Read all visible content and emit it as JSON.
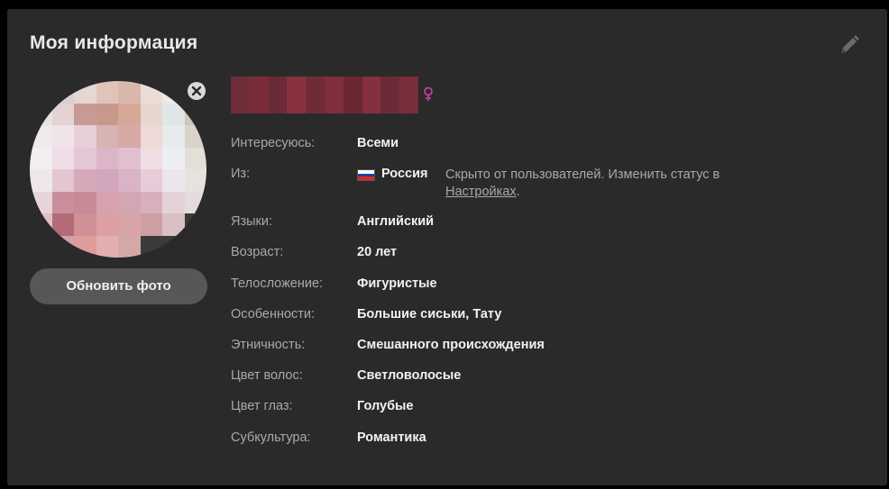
{
  "panel": {
    "title": "Моя информация",
    "edit_icon": "pencil-icon"
  },
  "profile": {
    "name_redacted": true,
    "gender_icon": "female-icon",
    "gender_color": "#c2409a",
    "remove_photo_icon": "close-circle-icon",
    "update_photo_label": "Обновить фото"
  },
  "fields": {
    "interest": {
      "label": "Интересуюсь:",
      "value": "Всеми"
    },
    "from": {
      "label": "Из:",
      "country": "Россия",
      "flag_icon": "russia-flag-icon",
      "note_text": "Скрыто от пользователей. Изменить статус в ",
      "note_link": "Настройках",
      "note_end": "."
    },
    "languages": {
      "label": "Языки:",
      "value": "Английский"
    },
    "age": {
      "label": "Возраст:",
      "value": "20 лет"
    },
    "build": {
      "label": "Телосложение:",
      "value": "Фигуристые"
    },
    "features": {
      "label": "Особенности:",
      "value": "Большие сиськи, Тату"
    },
    "ethnicity": {
      "label": "Этничность:",
      "value": "Смешанного происхождения"
    },
    "hair": {
      "label": "Цвет волос:",
      "value": "Светловолосые"
    },
    "eyes": {
      "label": "Цвет глаз:",
      "value": "Голубые"
    },
    "subculture": {
      "label": "Субкультура:",
      "value": "Романтика"
    }
  },
  "colors": {
    "panel_bg": "#2a2a2a",
    "label": "#a9a9a9",
    "value": "#f2f2f2",
    "button_bg": "#575757"
  }
}
